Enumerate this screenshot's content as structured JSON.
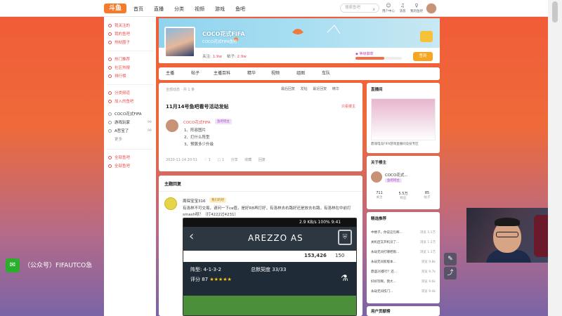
{
  "topbar": {
    "logo": "斗鱼",
    "nav": [
      "首页",
      "直播",
      "分类",
      "视频",
      "游戏",
      "鱼吧"
    ],
    "search_placeholder": "搜索鱼吧",
    "icons": [
      {
        "icon": "person-icon",
        "label": "用户中心"
      },
      {
        "icon": "bell-icon",
        "label": "消息"
      },
      {
        "icon": "bulb-icon",
        "label": "我的鱼吧"
      }
    ]
  },
  "sidebar": {
    "group1": [
      "我关注的",
      "我的鱼吧",
      "热帖圈子"
    ],
    "group2": [
      "热门推荐",
      "社区热搜",
      "排行榜"
    ],
    "group3": [
      "分类频道",
      "加入的鱼吧"
    ],
    "bars": [
      {
        "label": "COCO花式FIFA",
        "count": ""
      },
      {
        "label": "游戏玩家",
        "count": "99"
      },
      {
        "label": "A哲宝了",
        "count": "99"
      },
      {
        "label": "更多",
        "count": ""
      }
    ],
    "group4": [
      "全部鱼吧",
      "全部鱼吧"
    ]
  },
  "bar": {
    "title": "COCO花式FIFA",
    "subtitle": "COCO花式FIFA鱼吧",
    "fans_label": "关注:",
    "fans": "1.9w",
    "posts_label": "帖子:",
    "posts": "2.9w",
    "level_label": "等级徽章",
    "sign_label": "签到"
  },
  "tabs": [
    "主播",
    "帖子",
    "主播百科",
    "精华",
    "视频",
    "组图",
    "车队"
  ],
  "feed": {
    "filter_text": "全部动态 · 共 1 条",
    "sort_buttons": [
      "最后回复",
      "发帖",
      "最近回复",
      "精华"
    ],
    "post": {
      "title": "11月14号鱼吧看号活动发帖",
      "report": "只看楼主",
      "author": "COCO花式FIFA",
      "badge": "鱼吧吧主",
      "lines": [
        "1、阵容图片",
        "2、打什么阵型",
        "3、预算多少升级"
      ],
      "time": "2020-11-14 20:51",
      "meta": [
        "1",
        "1",
        "分享",
        "收藏",
        "回复"
      ]
    }
  },
  "replies": {
    "header": "主题回复",
    "author": "周琛宝宝316",
    "badge": "我们的吧",
    "text": "有洛林不可交易，请问一下ca值，是好RB再打好，有洛林去右路好还是放去右路，有洛林在中前打smash呀？（打4222过4231）"
  },
  "phone": {
    "status": "2.9 KB/s  100%  9:41",
    "player": "AREZZO AS",
    "coins": "153,426",
    "points": "150",
    "formation": "阵型: 4-1-3-2",
    "chemistry": "总默契度 33/33",
    "rating": "评分 87"
  },
  "right": {
    "live_header": "直播间",
    "live_caption": "鼎瑞电竞FIFA游戏直播间竞技专区",
    "owner_header": "关于楼主",
    "owner_name": "COCO花式...",
    "owner_badge": "鱼吧吧主",
    "owner_stats": [
      {
        "value": "711",
        "label": "关注"
      },
      {
        "value": "5.5万",
        "label": "粉丝"
      },
      {
        "value": "85",
        "label": "帖子"
      }
    ],
    "rec_header": "精选推荐",
    "recs": [
      {
        "text": "中楼子，你说这包啊...",
        "val": "浏览 5.1万"
      },
      {
        "text": "关机后又开机没了...",
        "val": "浏览 1.2万"
      },
      {
        "text": "永劫无间打哪把限...",
        "val": "浏览 1.1万"
      },
      {
        "text": "永劫无间新版本...",
        "val": "浏览 9.8k"
      },
      {
        "text": "鼎盛20都行？还...",
        "val": "浏览 9.7k"
      },
      {
        "text": "好好玩啊，我大...",
        "val": "浏览 9.6k"
      },
      {
        "text": "永劫无间伤门...",
        "val": "浏览 9.4k"
      }
    ],
    "user_header": "用户贡献榜"
  },
  "watermark": "（公众号）FIFAUTCO急"
}
